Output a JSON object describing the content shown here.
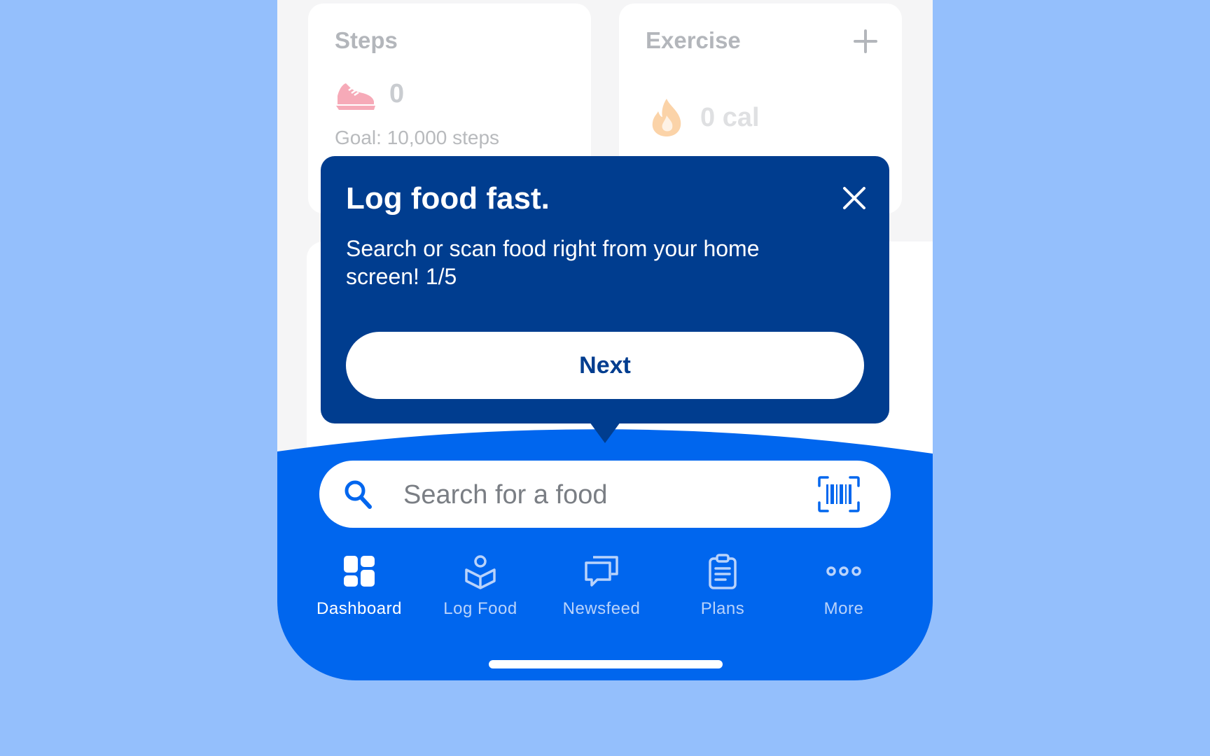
{
  "steps_card": {
    "title": "Steps",
    "value": "0",
    "goal": "Goal: 10,000 steps"
  },
  "exercise_card": {
    "title": "Exercise",
    "value": "0 cal"
  },
  "tooltip": {
    "title": "Log food fast.",
    "body": "Search or scan food right from your home screen! 1/5",
    "next_label": "Next"
  },
  "search": {
    "placeholder": "Search for a food"
  },
  "nav": {
    "items": [
      {
        "label": "Dashboard",
        "icon": "dashboard-icon",
        "active": true
      },
      {
        "label": "Log Food",
        "icon": "log-food-icon",
        "active": false
      },
      {
        "label": "Newsfeed",
        "icon": "newsfeed-icon",
        "active": false
      },
      {
        "label": "Plans",
        "icon": "plans-icon",
        "active": false
      },
      {
        "label": "More",
        "icon": "more-icon",
        "active": false
      }
    ]
  },
  "colors": {
    "background": "#94bffc",
    "brand_blue": "#0066ee",
    "tooltip_navy": "#003d8f"
  }
}
